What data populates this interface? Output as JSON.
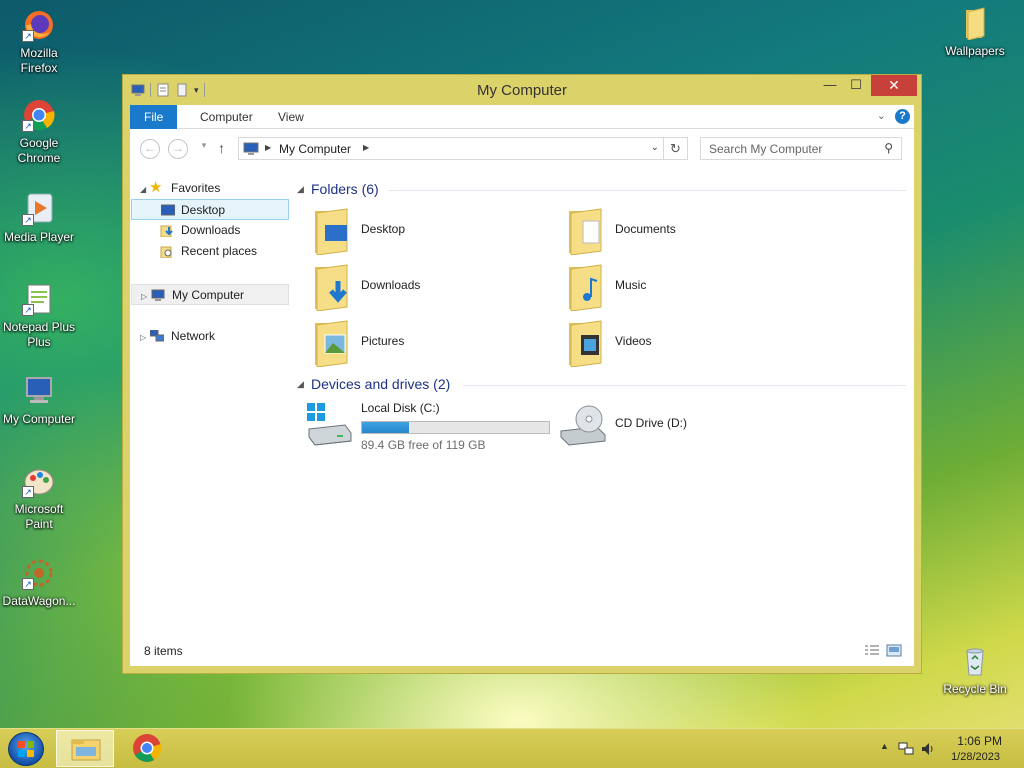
{
  "desktop": {
    "icons": [
      {
        "label": "Mozilla Firefox",
        "icon": "firefox-icon"
      },
      {
        "label": "Google Chrome",
        "icon": "chrome-icon"
      },
      {
        "label": "Media Player",
        "icon": "media-player-icon"
      },
      {
        "label": "Notepad Plus Plus",
        "icon": "notepad-icon"
      },
      {
        "label": "My Computer",
        "icon": "computer-icon"
      },
      {
        "label": "Microsoft Paint",
        "icon": "paint-icon"
      },
      {
        "label": "DataWagon...",
        "icon": "datawagon-icon"
      },
      {
        "label": "Wallpapers",
        "icon": "folder-icon"
      },
      {
        "label": "Recycle Bin",
        "icon": "recycle-bin-icon"
      }
    ]
  },
  "window": {
    "title": "My Computer",
    "close_glyph": "✕",
    "maximize_glyph": "☐",
    "minimize_glyph": "—",
    "ribbon_tabs": [
      "File",
      "Computer",
      "View"
    ],
    "address": "My Computer",
    "search_placeholder": "Search My Computer"
  },
  "navpane": {
    "items": [
      {
        "label": "Favorites"
      },
      {
        "label": "Desktop"
      },
      {
        "label": "Downloads"
      },
      {
        "label": "Recent places"
      },
      {
        "label": "My Computer"
      },
      {
        "label": "Network"
      }
    ]
  },
  "content": {
    "folders_header": "Folders (6)",
    "folders": [
      "Desktop",
      "Documents",
      "Downloads",
      "Music",
      "Pictures",
      "Videos"
    ],
    "devices_header": "Devices and drives (2)",
    "drives": [
      {
        "label": "Local Disk (C:)",
        "free_text": "89.4 GB free of 119 GB",
        "used_fraction": 0.249
      },
      {
        "label": "CD Drive (D:)"
      }
    ]
  },
  "status": {
    "items_count": "8 items"
  },
  "taskbar": {
    "time": "1:06 PM",
    "date": "1/28/2023"
  },
  "colors": {
    "accent": "#1979ca",
    "folder_header": "#1e3287",
    "close_red": "#c7413a",
    "drive_bar": "#2686cc"
  }
}
